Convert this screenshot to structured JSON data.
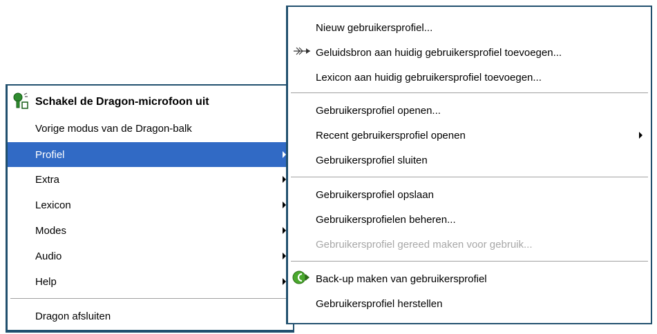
{
  "main_menu": {
    "items": [
      {
        "label": "Schakel de Dragon-microfoon uit",
        "icon": "microphone-icon"
      },
      {
        "label": "Vorige modus van de Dragon-balk"
      },
      {
        "label": "Profiel",
        "selected": true
      },
      {
        "label": "Extra"
      },
      {
        "label": "Lexicon"
      },
      {
        "label": "Modes"
      },
      {
        "label": "Audio"
      },
      {
        "label": "Help"
      },
      {
        "label": "Dragon afsluiten"
      }
    ]
  },
  "sub_menu": {
    "items": [
      {
        "label": "Nieuw gebruikersprofiel..."
      },
      {
        "label": "Geluidsbron aan huidig gebruikersprofiel toevoegen...",
        "icon": "audio-source-icon"
      },
      {
        "label": "Lexicon aan huidig gebruikersprofiel toevoegen..."
      },
      {
        "label": "Gebruikersprofiel openen..."
      },
      {
        "label": "Recent gebruikersprofiel openen"
      },
      {
        "label": "Gebruikersprofiel sluiten"
      },
      {
        "label": "Gebruikersprofiel opslaan"
      },
      {
        "label": "Gebruikersprofielen beheren..."
      },
      {
        "label": "Gebruikersprofiel gereed maken voor gebruik...",
        "disabled": true
      },
      {
        "label": "Back-up maken van gebruikersprofiel",
        "icon": "backup-icon"
      },
      {
        "label": "Gebruikersprofiel herstellen"
      }
    ]
  },
  "colors": {
    "highlight": "#316ac5",
    "border": "#21506e",
    "disabled_text": "#a7a7a7"
  }
}
